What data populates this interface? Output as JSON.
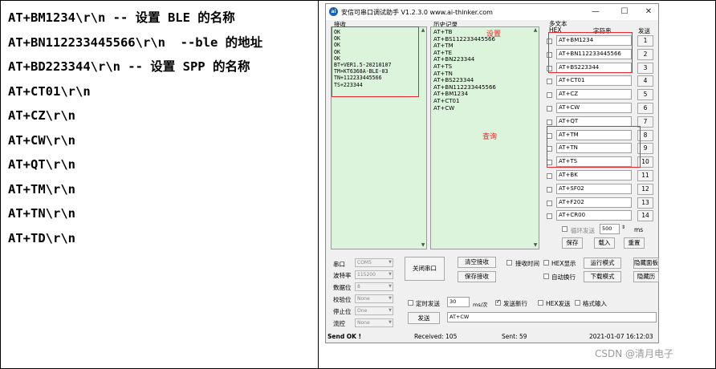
{
  "left_commands": [
    "AT+BM1234\\r\\n -- 设置 BLE 的名称",
    "AT+BN112233445566\\r\\n  --ble 的地址",
    "AT+BD223344\\r\\n -- 设置 SPP 的名称",
    "AT+CT01\\r\\n",
    "AT+CZ\\r\\n",
    "AT+CW\\r\\n",
    "AT+QT\\r\\n",
    "AT+TM\\r\\n",
    "AT+TN\\r\\n",
    "AT+TD\\r\\n"
  ],
  "app": {
    "title": "安信可串口调试助手 V1.2.3.0    www.ai-thinker.com",
    "icon": "ai-icon",
    "icon_text": "ai",
    "controls": {
      "minimize": "—",
      "maximize": "☐",
      "close": "✕"
    }
  },
  "receive": {
    "label": "接收",
    "lines": [
      "OK",
      "OK",
      "OK",
      "OK",
      "OK",
      "BT+VER1.5-20210107",
      "TM+KT6368A-BLE-03",
      "TN+112233445566",
      "TS+223344"
    ]
  },
  "history": {
    "label": "历史记录",
    "lines": [
      "AT+TB",
      "AT+BS112233445566",
      "AT+TM",
      "AT+TE",
      "AT+BN223344",
      "AT+TS",
      "AT+TN",
      "AT+BS223344",
      "AT+BN112233445566",
      "AT+BM1234",
      "AT+CT01",
      "AT+CW"
    ]
  },
  "annotations": {
    "set": "设置",
    "query": "查询"
  },
  "multitext": {
    "label": "多文本",
    "col_hex": "HEX",
    "col_string": "字符串",
    "col_send": "发送",
    "items": [
      {
        "text": "AT+BM1234",
        "num": "1"
      },
      {
        "text": "AT+BN112233445566",
        "num": "2"
      },
      {
        "text": "AT+BS223344",
        "num": "3"
      },
      {
        "text": "AT+CT01",
        "num": "4"
      },
      {
        "text": "AT+CZ",
        "num": "5"
      },
      {
        "text": "AT+CW",
        "num": "6"
      },
      {
        "text": "AT+QT",
        "num": "7"
      },
      {
        "text": "AT+TM",
        "num": "8"
      },
      {
        "text": "AT+TN",
        "num": "9"
      },
      {
        "text": "AT+TS",
        "num": "10"
      },
      {
        "text": "AT+BK",
        "num": "11"
      },
      {
        "text": "AT+SF02",
        "num": "12"
      },
      {
        "text": "AT+F202",
        "num": "13"
      },
      {
        "text": "AT+CR00",
        "num": "14"
      }
    ],
    "loop_label": "循环发送",
    "loop_value": "500",
    "loop_unit": "ms",
    "save": "保存",
    "load": "载入",
    "reset": "重置"
  },
  "serial": {
    "port_label": "串口",
    "port_value": "COM5",
    "baud_label": "波特率",
    "baud_value": "115200",
    "data_label": "数据位",
    "data_value": "8",
    "parity_label": "校验位",
    "parity_value": "None",
    "stop_label": "停止位",
    "stop_value": "One",
    "flow_label": "流控",
    "flow_value": "None"
  },
  "buttons": {
    "close_port": "关闭串口",
    "clear_receive": "清空接收",
    "save_receive": "保存接收",
    "receive_time": "接收时间",
    "hex_display": "HEX显示",
    "run_mode": "运行模式",
    "hide_panel": "隐藏面板",
    "auto_wrap": "自动换行",
    "download_mode": "下载模式",
    "hide_history": "隐藏历",
    "timed_send": "定时发送",
    "timed_value": "30",
    "timed_unit": "ms/次",
    "send_newline": "发送新行",
    "hex_send": "HEX发送",
    "format_input": "格式输入",
    "send": "发送",
    "send_text": "AT+CW"
  },
  "status": {
    "send_ok": "Send OK !",
    "received": "Received: 105",
    "sent": "Sent: 59",
    "timestamp": "2021-01-07 16:12:03"
  },
  "watermark": "CSDN @清月电子"
}
